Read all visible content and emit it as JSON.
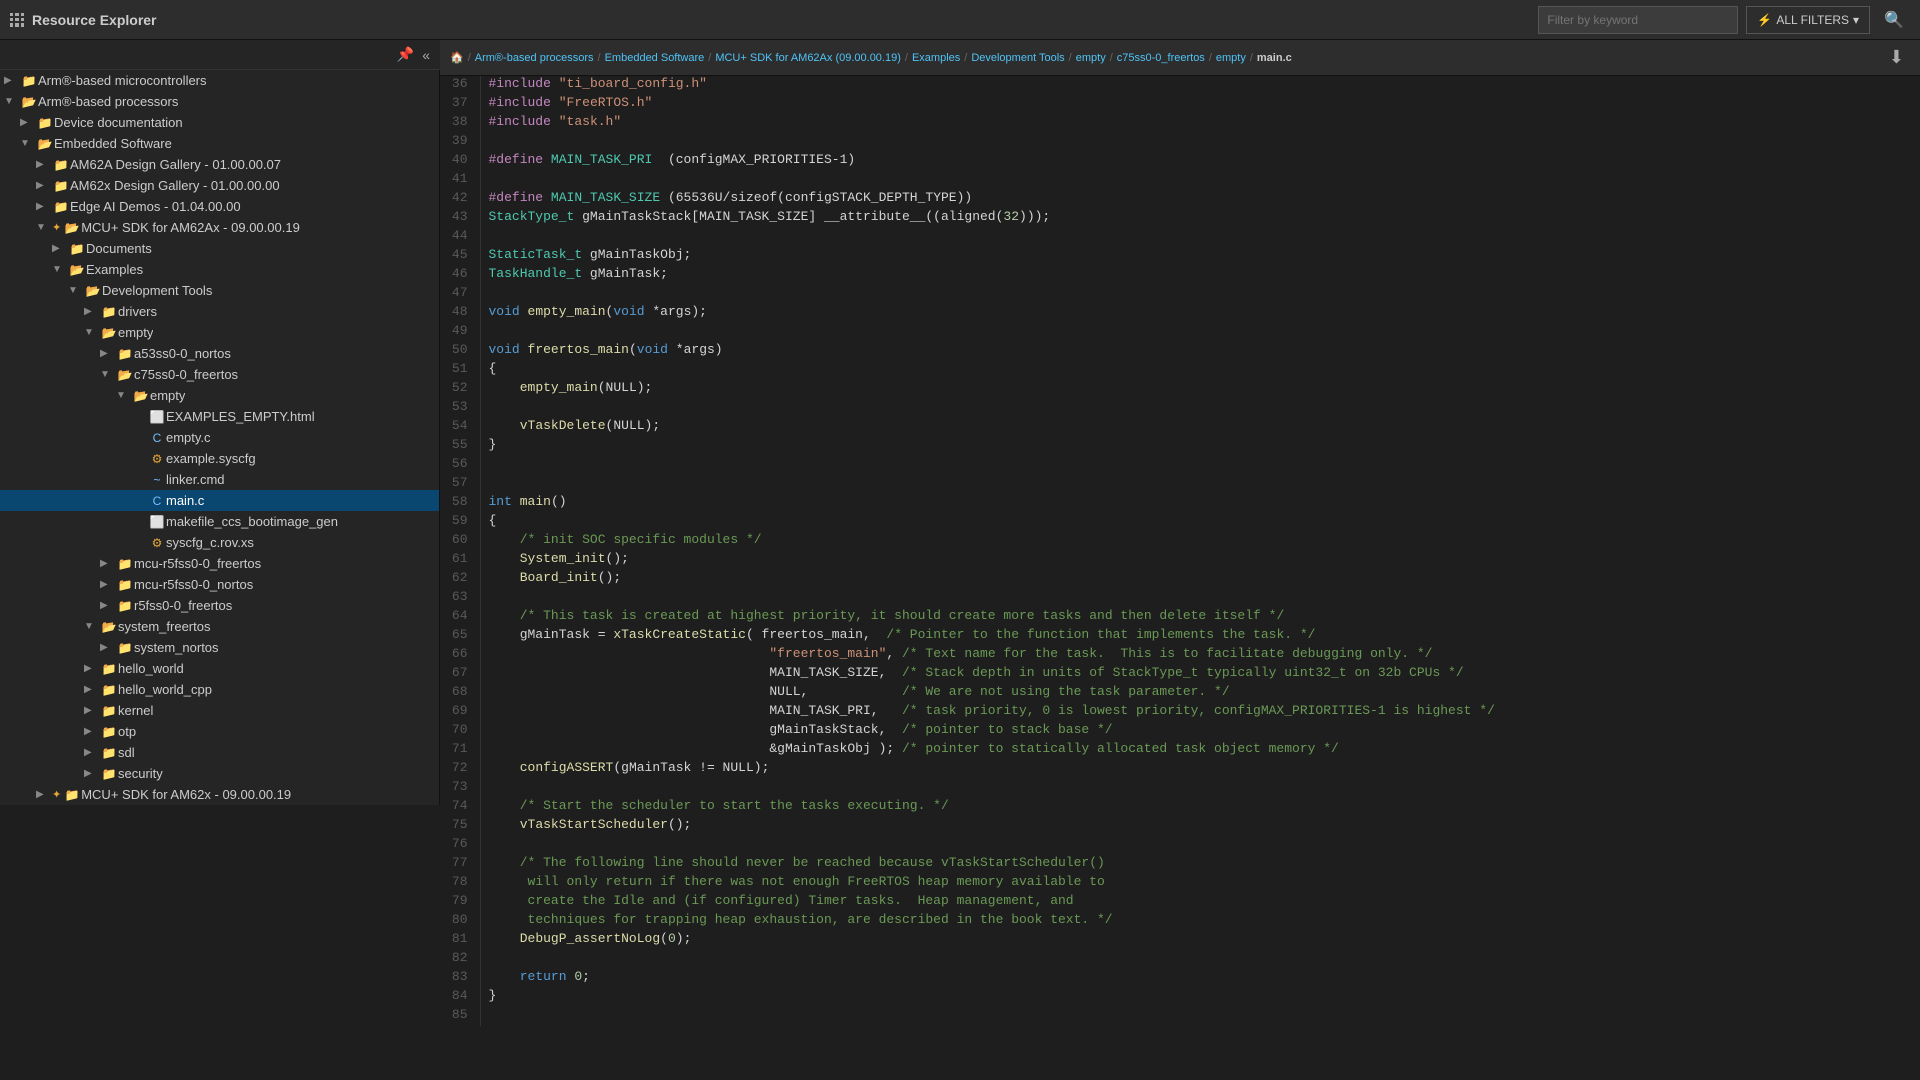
{
  "app": {
    "title": "Resource Explorer"
  },
  "topbar": {
    "filter_placeholder": "Filter by keyword",
    "all_filters": "ALL FILTERS"
  },
  "breadcrumb": {
    "items": [
      {
        "label": "🏠",
        "type": "home"
      },
      {
        "label": "Arm®-based processors",
        "type": "link"
      },
      {
        "label": "Embedded Software",
        "type": "link"
      },
      {
        "label": "MCU+ SDK for AM62Ax (09.00.00.19)",
        "type": "link"
      },
      {
        "label": "Examples",
        "type": "link"
      },
      {
        "label": "Development Tools",
        "type": "link"
      },
      {
        "label": "empty",
        "type": "link"
      },
      {
        "label": "c75ss0-0_freertos",
        "type": "link"
      },
      {
        "label": "empty",
        "type": "link"
      },
      {
        "label": "main.c",
        "type": "current"
      }
    ]
  },
  "tree": [
    {
      "id": "arm-mcu",
      "label": "Arm®-based microcontrollers",
      "level": 0,
      "type": "folder",
      "expanded": false,
      "color": "blue"
    },
    {
      "id": "arm-proc",
      "label": "Arm®-based processors",
      "level": 0,
      "type": "folder",
      "expanded": true,
      "color": "blue"
    },
    {
      "id": "device-doc",
      "label": "Device documentation",
      "level": 1,
      "type": "folder",
      "expanded": false,
      "color": "blue"
    },
    {
      "id": "emb-sw",
      "label": "Embedded Software",
      "level": 1,
      "type": "folder",
      "expanded": true,
      "color": "blue"
    },
    {
      "id": "am62a-gallery",
      "label": "AM62A Design Gallery - 01.00.00.07",
      "level": 2,
      "type": "folder",
      "expanded": false,
      "color": "blue"
    },
    {
      "id": "am62x-gallery",
      "label": "AM62x Design Gallery - 01.00.00.00",
      "level": 2,
      "type": "folder",
      "expanded": false,
      "color": "blue"
    },
    {
      "id": "edge-ai",
      "label": "Edge AI Demos - 01.04.00.00",
      "level": 2,
      "type": "folder",
      "expanded": false,
      "color": "blue"
    },
    {
      "id": "mcu-am62ax",
      "label": "MCU+ SDK for AM62Ax - 09.00.00.19",
      "level": 2,
      "type": "folder",
      "expanded": true,
      "color": "blue",
      "starred": true
    },
    {
      "id": "documents",
      "label": "Documents",
      "level": 3,
      "type": "folder",
      "expanded": false,
      "color": "blue"
    },
    {
      "id": "examples",
      "label": "Examples",
      "level": 3,
      "type": "folder",
      "expanded": true,
      "color": "blue"
    },
    {
      "id": "dev-tools",
      "label": "Development Tools",
      "level": 4,
      "type": "folder",
      "expanded": true,
      "color": "blue"
    },
    {
      "id": "drivers",
      "label": "drivers",
      "level": 5,
      "type": "folder",
      "expanded": false,
      "color": "blue"
    },
    {
      "id": "empty",
      "label": "empty",
      "level": 5,
      "type": "folder",
      "expanded": true,
      "color": "blue"
    },
    {
      "id": "a53ss0-nortos",
      "label": "a53ss0-0_nortos",
      "level": 6,
      "type": "folder",
      "expanded": false,
      "color": "blue"
    },
    {
      "id": "c75ss0-freertos",
      "label": "c75ss0-0_freertos",
      "level": 6,
      "type": "folder",
      "expanded": true,
      "color": "blue"
    },
    {
      "id": "empty2",
      "label": "empty",
      "level": 7,
      "type": "folder",
      "expanded": true,
      "color": "blue"
    },
    {
      "id": "examples-empty-html",
      "label": "EXAMPLES_EMPTY.html",
      "level": 8,
      "type": "file-html",
      "color": "html"
    },
    {
      "id": "empty-c",
      "label": "empty.c",
      "level": 8,
      "type": "file-c",
      "color": "c"
    },
    {
      "id": "example-syscfg",
      "label": "example.syscfg",
      "level": 8,
      "type": "file-syscfg",
      "color": "syscfg"
    },
    {
      "id": "linker-cmd",
      "label": "linker.cmd",
      "level": 8,
      "type": "file-linker",
      "color": "linker"
    },
    {
      "id": "main-c",
      "label": "main.c",
      "level": 8,
      "type": "file-c",
      "color": "c",
      "selected": true
    },
    {
      "id": "makefile-ccs",
      "label": "makefile_ccs_bootimage_gen",
      "level": 8,
      "type": "file-make",
      "color": "make"
    },
    {
      "id": "syscfg-rov",
      "label": "syscfg_c.rov.xs",
      "level": 8,
      "type": "file-rov",
      "color": "rov"
    },
    {
      "id": "mcu-r5fss0-freertos",
      "label": "mcu-r5fss0-0_freertos",
      "level": 6,
      "type": "folder",
      "expanded": false,
      "color": "blue"
    },
    {
      "id": "mcu-r5fss0-nortos",
      "label": "mcu-r5fss0-0_nortos",
      "level": 6,
      "type": "folder",
      "expanded": false,
      "color": "blue"
    },
    {
      "id": "r5fss0-freertos",
      "label": "r5fss0-0_freertos",
      "level": 6,
      "type": "folder",
      "expanded": false,
      "color": "blue"
    },
    {
      "id": "system-freertos",
      "label": "system_freertos",
      "level": 5,
      "type": "folder",
      "expanded": true,
      "color": "blue"
    },
    {
      "id": "system-nortos",
      "label": "system_nortos",
      "level": 6,
      "type": "folder",
      "expanded": false,
      "color": "blue"
    },
    {
      "id": "hello-world",
      "label": "hello_world",
      "level": 5,
      "type": "folder",
      "expanded": false,
      "color": "blue"
    },
    {
      "id": "hello-world-cpp",
      "label": "hello_world_cpp",
      "level": 5,
      "type": "folder",
      "expanded": false,
      "color": "blue"
    },
    {
      "id": "kernel",
      "label": "kernel",
      "level": 5,
      "type": "folder",
      "expanded": false,
      "color": "blue"
    },
    {
      "id": "otp",
      "label": "otp",
      "level": 5,
      "type": "folder",
      "expanded": false,
      "color": "blue"
    },
    {
      "id": "sdl",
      "label": "sdl",
      "level": 5,
      "type": "folder",
      "expanded": false,
      "color": "blue"
    },
    {
      "id": "security",
      "label": "security",
      "level": 5,
      "type": "folder",
      "expanded": false,
      "color": "blue"
    },
    {
      "id": "mcu-am62x",
      "label": "MCU+ SDK for AM62x - 09.00.00.19",
      "level": 2,
      "type": "folder",
      "expanded": false,
      "color": "blue",
      "starred": true
    }
  ],
  "code": {
    "filename": "main.c",
    "lines": [
      {
        "n": 36,
        "code": "#include \"ti_board_config.h\""
      },
      {
        "n": 37,
        "code": "#include \"FreeRTOS.h\""
      },
      {
        "n": 38,
        "code": "#include \"task.h\""
      },
      {
        "n": 39,
        "code": ""
      },
      {
        "n": 40,
        "code": "#define MAIN_TASK_PRI  (configMAX_PRIORITIES-1)"
      },
      {
        "n": 41,
        "code": ""
      },
      {
        "n": 42,
        "code": "#define MAIN_TASK_SIZE (65536U/sizeof(configSTACK_DEPTH_TYPE))"
      },
      {
        "n": 43,
        "code": "StackType_t gMainTaskStack[MAIN_TASK_SIZE] __attribute__((aligned(32)));"
      },
      {
        "n": 44,
        "code": ""
      },
      {
        "n": 45,
        "code": "StaticTask_t gMainTaskObj;"
      },
      {
        "n": 46,
        "code": "TaskHandle_t gMainTask;"
      },
      {
        "n": 47,
        "code": ""
      },
      {
        "n": 48,
        "code": "void empty_main(void *args);"
      },
      {
        "n": 49,
        "code": ""
      },
      {
        "n": 50,
        "code": "void freertos_main(void *args)"
      },
      {
        "n": 51,
        "code": "{"
      },
      {
        "n": 52,
        "code": "    empty_main(NULL);"
      },
      {
        "n": 53,
        "code": ""
      },
      {
        "n": 54,
        "code": "    vTaskDelete(NULL);"
      },
      {
        "n": 55,
        "code": "}"
      },
      {
        "n": 56,
        "code": ""
      },
      {
        "n": 57,
        "code": ""
      },
      {
        "n": 58,
        "code": "int main()"
      },
      {
        "n": 59,
        "code": "{"
      },
      {
        "n": 60,
        "code": "    /* init SOC specific modules */"
      },
      {
        "n": 61,
        "code": "    System_init();"
      },
      {
        "n": 62,
        "code": "    Board_init();"
      },
      {
        "n": 63,
        "code": ""
      },
      {
        "n": 64,
        "code": "    /* This task is created at highest priority, it should create more tasks and then delete itself */"
      },
      {
        "n": 65,
        "code": "    gMainTask = xTaskCreateStatic( freertos_main,  /* Pointer to the function that implements the task. */"
      },
      {
        "n": 66,
        "code": "                                    \"freertos_main\", /* Text name for the task.  This is to facilitate debugging only. */"
      },
      {
        "n": 67,
        "code": "                                    MAIN_TASK_SIZE,  /* Stack depth in units of StackType_t typically uint32_t on 32b CPUs */"
      },
      {
        "n": 68,
        "code": "                                    NULL,            /* We are not using the task parameter. */"
      },
      {
        "n": 69,
        "code": "                                    MAIN_TASK_PRI,   /* task priority, 0 is lowest priority, configMAX_PRIORITIES-1 is highest */"
      },
      {
        "n": 70,
        "code": "                                    gMainTaskStack,  /* pointer to stack base */"
      },
      {
        "n": 71,
        "code": "                                    &gMainTaskObj ); /* pointer to statically allocated task object memory */"
      },
      {
        "n": 72,
        "code": "    configASSERT(gMainTask != NULL);"
      },
      {
        "n": 73,
        "code": ""
      },
      {
        "n": 74,
        "code": "    /* Start the scheduler to start the tasks executing. */"
      },
      {
        "n": 75,
        "code": "    vTaskStartScheduler();"
      },
      {
        "n": 76,
        "code": ""
      },
      {
        "n": 77,
        "code": "    /* The following line should never be reached because vTaskStartScheduler()"
      },
      {
        "n": 78,
        "code": "     will only return if there was not enough FreeRTOS heap memory available to"
      },
      {
        "n": 79,
        "code": "     create the Idle and (if configured) Timer tasks.  Heap management, and"
      },
      {
        "n": 80,
        "code": "     techniques for trapping heap exhaustion, are described in the book text. */"
      },
      {
        "n": 81,
        "code": "    DebugP_assertNoLog(0);"
      },
      {
        "n": 82,
        "code": ""
      },
      {
        "n": 83,
        "code": "    return 0;"
      },
      {
        "n": 84,
        "code": "}"
      },
      {
        "n": 85,
        "code": ""
      }
    ]
  }
}
